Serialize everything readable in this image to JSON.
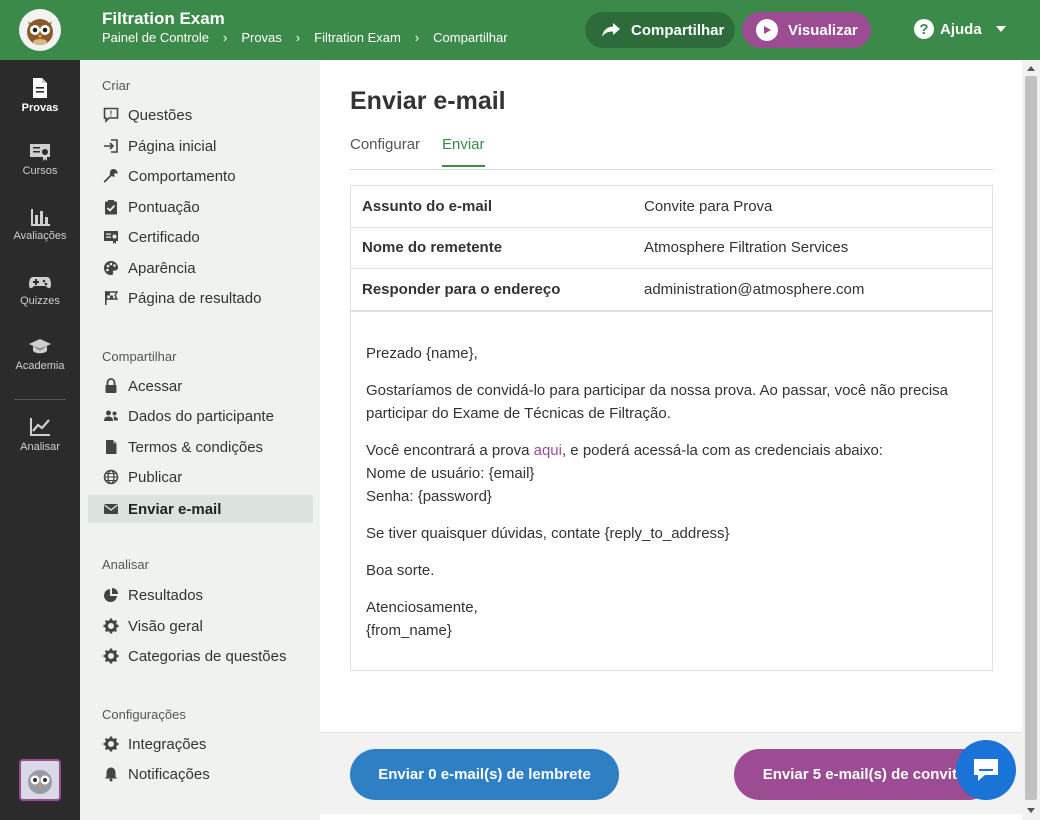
{
  "header": {
    "title": "Filtration Exam",
    "breadcrumb": [
      "Painel de Controle",
      "Provas",
      "Filtration Exam",
      "Compartilhar"
    ],
    "share_label": "Compartilhar",
    "preview_label": "Visualizar",
    "help_label": "Ajuda"
  },
  "leftnav": {
    "items": [
      {
        "label": "Provas",
        "icon": "document-icon",
        "active": true
      },
      {
        "label": "Cursos",
        "icon": "certificate-icon"
      },
      {
        "label": "Avaliações",
        "icon": "bar-chart-icon"
      },
      {
        "label": "Quizzes",
        "icon": "gamepad-icon"
      },
      {
        "label": "Academia",
        "icon": "graduation-cap-icon"
      },
      {
        "label": "Analisar",
        "icon": "line-chart-icon"
      }
    ]
  },
  "sidebar": {
    "sections": [
      {
        "title": "Criar",
        "items": [
          "Questões",
          "Página inicial",
          "Comportamento",
          "Pontuação",
          "Certificado",
          "Aparência",
          "Página de resultado"
        ]
      },
      {
        "title": "Compartilhar",
        "items": [
          "Acessar",
          "Dados do participante",
          "Termos & condições",
          "Publicar",
          "Enviar e-mail"
        ]
      },
      {
        "title": "Analisar",
        "items": [
          "Resultados",
          "Visão geral",
          "Categorias de questões"
        ]
      },
      {
        "title": "Configurações",
        "items": [
          "Integrações",
          "Notificações"
        ]
      }
    ],
    "active_item": "Enviar e-mail"
  },
  "main": {
    "title": "Enviar e-mail",
    "tabs": [
      "Configurar",
      "Enviar"
    ],
    "active_tab": "Enviar",
    "fields": [
      {
        "label": "Assunto do e-mail",
        "value": "Convite para Prova"
      },
      {
        "label": "Nome do remetente",
        "value": "Atmosphere Filtration Services"
      },
      {
        "label": "Responder para o endereço",
        "value": "administration@atmosphere.com"
      }
    ],
    "body": {
      "greeting": "Prezado {name},",
      "p1": "Gostaríamos de convidá-lo para participar da nossa prova. Ao passar, você não precisa participar do Exame de Técnicas de Filtração.",
      "p2_pre": "Você encontrará a prova ",
      "p2_link": "aqui",
      "p2_post": ", e poderá acessá-la com as credenciais abaixo:",
      "username_line": "Nome de usuário: {email}",
      "password_line": "Senha: {password}",
      "p3": "Se tiver quaisquer dúvidas, contate {reply_to_address}",
      "p4": "Boa sorte.",
      "closing": "Atenciosamente,",
      "signature": "{from_name}"
    }
  },
  "footer": {
    "reminder_label": "Enviar 0 e-mail(s) de lembrete",
    "invite_label": "Enviar 5 e-mail(s) de convite"
  },
  "colors": {
    "header_green": "#3b8a4a",
    "accent_purple": "#9b4c93",
    "reminder_blue": "#2f7fc5",
    "chat_blue": "#1a73d6"
  }
}
